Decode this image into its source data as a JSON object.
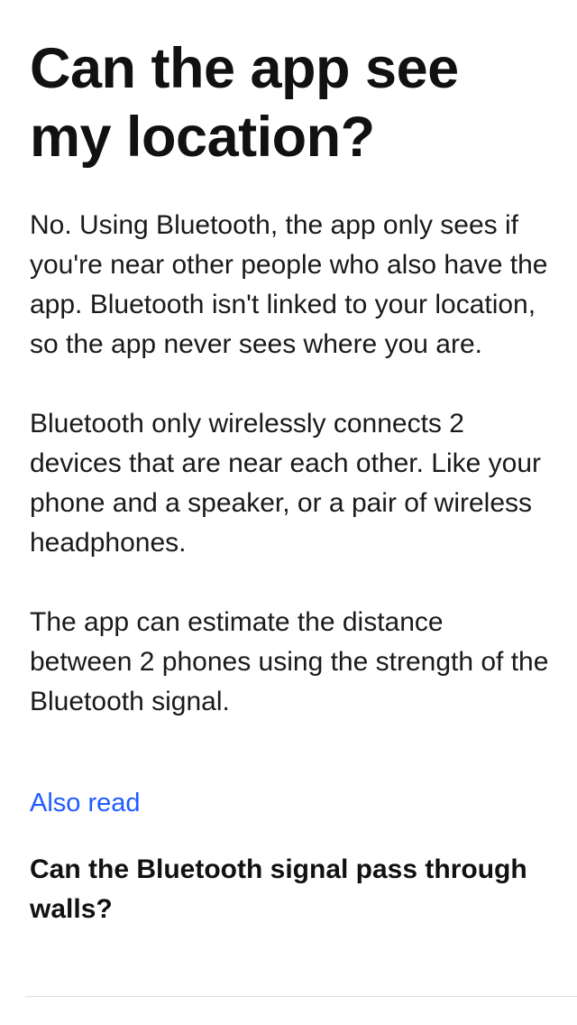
{
  "article": {
    "title": "Can the app see my location?",
    "paragraphs": [
      "No. Using Bluetooth, the app only sees if you're near other people who also have the app. Bluetooth isn't linked to your location, so the app never sees where you are.",
      "Bluetooth only wirelessly connects 2 devices that are near each other. Like your phone and a speaker, or a pair of wireless headphones.",
      "The app can estimate the distance between 2 phones using the strength of the Bluetooth signal."
    ]
  },
  "related": {
    "heading": "Also read",
    "items": [
      {
        "label": "Can the Bluetooth signal pass through walls?"
      }
    ]
  },
  "colors": {
    "link": "#1f5cff",
    "text": "#111111",
    "divider": "#e1e1e1",
    "background": "#ffffff"
  }
}
